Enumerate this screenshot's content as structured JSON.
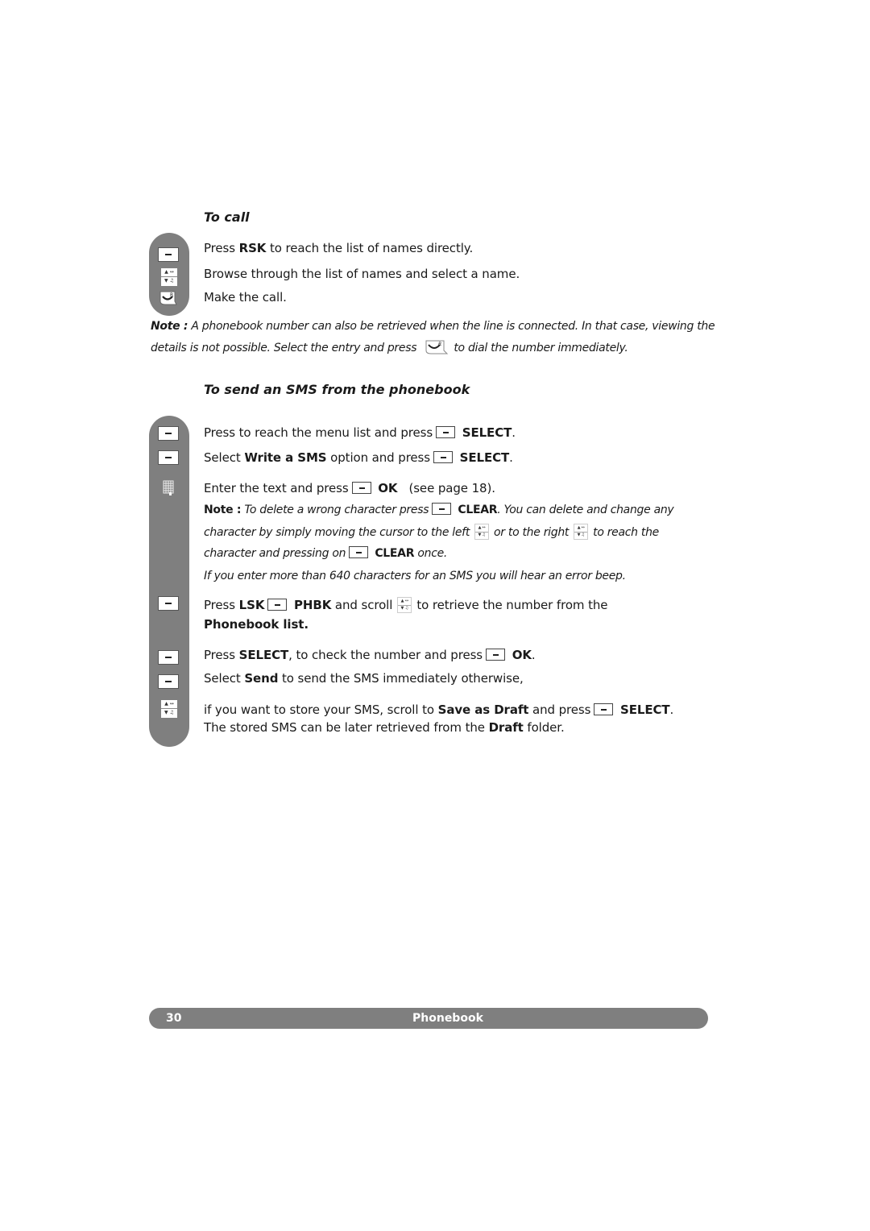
{
  "to_call": {
    "heading": "To call",
    "lines": [
      {
        "pre": "Press ",
        "bold": "RSK",
        "post": " to reach the list of names directly."
      },
      {
        "text": "Browse through the list of names and select a name."
      },
      {
        "text": "Make the call."
      }
    ],
    "note_label": "Note :",
    "note_line1": " A phonebook number can also be retrieved when the line is connected. In that case, viewing the",
    "note_line2_pre": "details is not possible. Select the entry and press",
    "note_line2_post": "to dial the number immediately."
  },
  "send_sms": {
    "heading": "To send an SMS from the phonebook",
    "step1_pre": "Press to reach the menu list and press",
    "step1_key": "SELECT",
    "step2_pre": "Select ",
    "step2_bold": "Write a SMS",
    "step2_mid": " option and press",
    "step2_key": "SELECT",
    "step3_pre": "Enter the text and press",
    "step3_key": "OK",
    "step3_post": "(see page 18).",
    "note_label": "Note :",
    "note1_pre": " To delete a wrong character press",
    "note1_key": "CLEAR",
    "note1_post": "You can delete and change any",
    "note2_pre": "character by simply moving the cursor to the left",
    "note2_mid": "or to the right",
    "note2_post": "to reach the",
    "note3_pre": "character and pressing on",
    "note3_key": "CLEAR",
    "note3_post": "once.",
    "note4": "If you enter more than 640 characters for an SMS you will hear an error beep.",
    "step4_pre": "Press ",
    "step4_bold": "LSK",
    "step4_key": "PHBK",
    "step4_mid": " and scroll",
    "step4_post": "to retrieve the number from the",
    "step4_line2": "Phonebook list.",
    "step5_pre": "Press ",
    "step5_bold": "SELECT",
    "step5_mid": ", to check the number and press",
    "step5_key": "OK",
    "step6_pre": "Select ",
    "step6_bold": "Send",
    "step6_post": " to send the SMS immediately otherwise,",
    "step7_pre": "if you want to store your SMS, scroll to ",
    "step7_bold": "Save as Draft",
    "step7_mid": " and press",
    "step7_key": "SELECT",
    "step8_pre": "The stored SMS can be later retrieved from the ",
    "step8_bold": "Draft",
    "step8_post": " folder."
  },
  "footer": {
    "page_number": "30",
    "section": "Phonebook"
  },
  "icons": {
    "nav_up": "▲ ↔",
    "nav_down": "▼ ♫"
  }
}
